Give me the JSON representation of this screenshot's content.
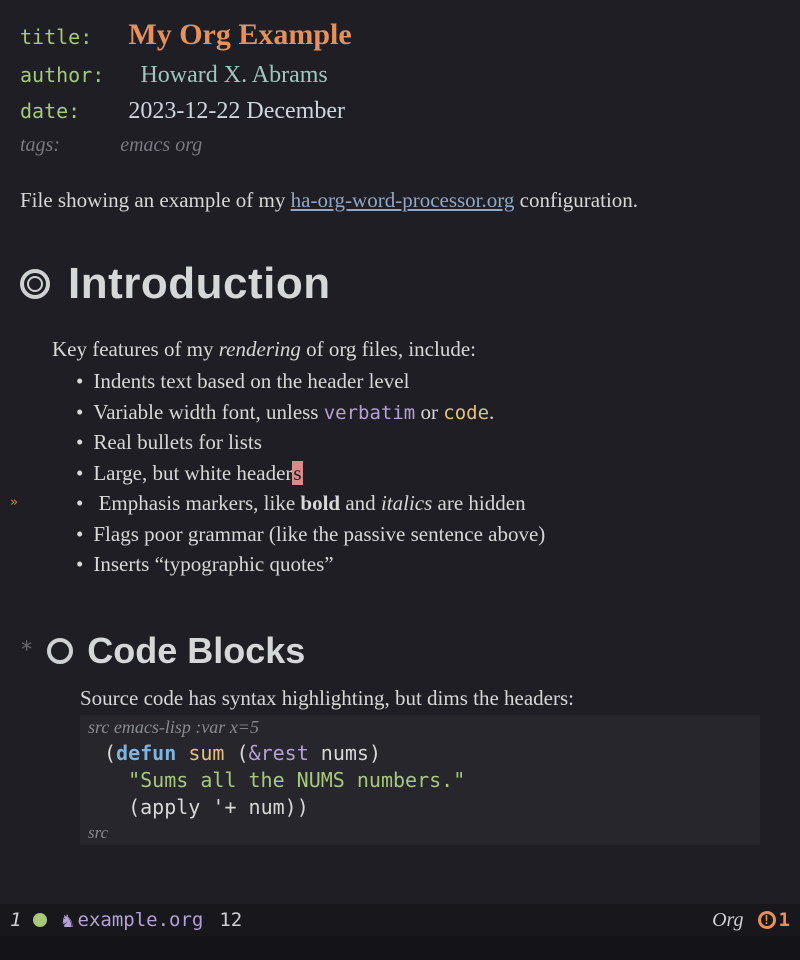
{
  "meta": {
    "title_key": "title:",
    "title_val": "My Org Example",
    "author_key": "author:",
    "author_val": "Howard X. Abrams",
    "date_key": "date:",
    "date_val": "2023-12-22 December",
    "tags_key": "tags:",
    "tags_val": "emacs org"
  },
  "intro_prose_pre": "File showing an example of my ",
  "intro_link": "ha-org-word-processor.org",
  "intro_prose_post": " configuration.",
  "h1": "Introduction",
  "features_lead_pre": "Key features of my ",
  "features_lead_em": "rendering",
  "features_lead_post": " of org files, include:",
  "features": {
    "f1": "Indents text based on the header level",
    "f2_pre": "Variable width font, unless ",
    "f2_verbatim": "verbatim",
    "f2_mid": " or ",
    "f2_code": "code",
    "f2_post": ".",
    "f3": "Real bullets for lists",
    "f4_pre": "Large, but white header",
    "f4_cursor": "s",
    "f5_pre": "Emphasis markers, like ",
    "f5_bold": "bold",
    "f5_mid": " and ",
    "f5_italic": "italics",
    "f5_post": " are hidden",
    "f6": "Flags poor grammar (like the passive sentence above)",
    "f7": "Inserts “typographic quotes”"
  },
  "h2": "Code Blocks",
  "src_lead": "Source code has syntax highlighting, but dims the headers:",
  "src_header_pre": "src ",
  "src_header_lang": "emacs-lisp :var x=5",
  "code": {
    "l1_p1": "(",
    "l1_kw": "defun",
    "l1_sp": " ",
    "l1_fn": "sum",
    "l1_sp2": " ",
    "l1_p2": "(",
    "l1_amp": "&rest",
    "l1_sp3": " ",
    "l1_var": "nums",
    "l1_p3": ")",
    "l2_str": "\"Sums all the NUMS numbers.\"",
    "l3_p1": "(",
    "l3_fn": "apply",
    "l3_rest": " '+ num))"
  },
  "src_footer": "src",
  "modeline": {
    "winnum": "1",
    "icon": "♞",
    "file": "example.org",
    "line": "12",
    "mode": "Org",
    "warn_icon": "!",
    "warn_count": "1"
  }
}
